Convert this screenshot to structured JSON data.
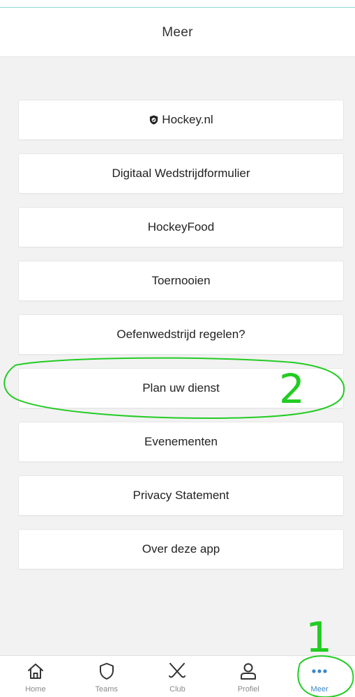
{
  "header": {
    "title": "Meer"
  },
  "menu": {
    "items": [
      {
        "label": "Hockey.nl",
        "icon": "shield-check-icon"
      },
      {
        "label": "Digitaal Wedstrijdformulier"
      },
      {
        "label": "HockeyFood"
      },
      {
        "label": "Toernooien"
      },
      {
        "label": "Oefenwedstrijd regelen?"
      },
      {
        "label": "Plan uw dienst"
      },
      {
        "label": "Evenementen"
      },
      {
        "label": "Privacy Statement"
      },
      {
        "label": "Over deze app"
      }
    ]
  },
  "tabbar": {
    "tabs": [
      {
        "label": "Home",
        "icon": "home-icon"
      },
      {
        "label": "Teams",
        "icon": "shield-icon"
      },
      {
        "label": "Club",
        "icon": "crossed-sticks-icon"
      },
      {
        "label": "Profiel",
        "icon": "user-icon"
      },
      {
        "label": "Meer",
        "icon": "more-dots-icon",
        "active": true
      }
    ]
  },
  "annotations": {
    "mark_1": "1",
    "mark_2": "2"
  },
  "colors": {
    "accent": "#3b86c9",
    "annotation": "#22cc22",
    "top_line": "#8fd6d0"
  }
}
